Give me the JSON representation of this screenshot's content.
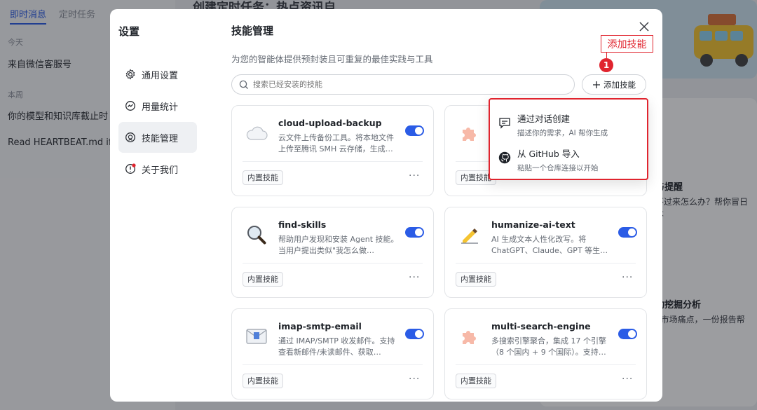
{
  "background": {
    "tabs": [
      "即时消息",
      "定时任务"
    ],
    "section_today": "今天",
    "item_wechat": "来自微信客服号",
    "section_week": "本周",
    "item_model": "你的模型和知识库截止时",
    "item_heartbeat": "Read HEARTBEAT.md if",
    "banner": "创建定时任务：热点资讯自",
    "right_card1_title": "与提醒",
    "right_card1_desc1": "不过来怎么办？帮你冒日",
    "right_card1_desc2": "不",
    "right_card2_title": "动挖掘分析",
    "right_card2_desc": "E市场痛点，一份报告帮"
  },
  "modal": {
    "sidebar_title": "设置",
    "nav": [
      {
        "label": "通用设置",
        "icon": "gear-icon"
      },
      {
        "label": "用量统计",
        "icon": "chart-icon"
      },
      {
        "label": "技能管理",
        "icon": "skill-icon",
        "active": true
      },
      {
        "label": "关于我们",
        "icon": "info-icon",
        "badge": true
      }
    ],
    "title": "技能管理",
    "subtitle": "为您的智能体提供预封装且可重复的最佳实践与工具",
    "search_placeholder": "搜索已经安装的技能",
    "add_button": "添加技能",
    "skills": [
      {
        "name": "cloud-upload-backup",
        "desc": "云文件上传备份工具。将本地文件上传至腾讯 SMH 云存储，生成…",
        "tag": "内置技能",
        "enabled": true,
        "icon": "cloud-icon"
      },
      {
        "name": "",
        "desc": "",
        "tag": "内置技能",
        "enabled": true,
        "icon": "puzzle-icon"
      },
      {
        "name": "find-skills",
        "desc": "帮助用户发现和安装 Agent 技能。当用户提出类似\"我怎么做…",
        "tag": "内置技能",
        "enabled": true,
        "icon": "magnifier-icon"
      },
      {
        "name": "humanize-ai-text",
        "desc": "AI 生成文本人性化改写。将 ChatGPT、Claude、GPT 等生…",
        "tag": "内置技能",
        "enabled": true,
        "icon": "writing-hand-icon"
      },
      {
        "name": "imap-smtp-email",
        "desc": "通过 IMAP/SMTP 收发邮件。支持查看新邮件/未读邮件、获取…",
        "tag": "内置技能",
        "enabled": true,
        "icon": "email-icon"
      },
      {
        "name": "multi-search-engine",
        "desc": "多搜索引擎聚合，集成 17 个引擎（8 个国内 + 9 个国际）。支持…",
        "tag": "内置技能",
        "enabled": true,
        "icon": "puzzle-icon"
      }
    ],
    "more_label": "···"
  },
  "dropdown": {
    "items": [
      {
        "title": "通过对话创建",
        "desc": "描述你的需求，AI 帮你生成",
        "icon": "chat-icon"
      },
      {
        "title": "从 GitHub 导入",
        "desc": "粘贴一个仓库连接以开始",
        "icon": "github-icon"
      }
    ]
  },
  "annotation": {
    "label": "添加技能",
    "badge": "1"
  },
  "colors": {
    "accent": "#2b5ce6",
    "annotation": "#e0242e"
  }
}
